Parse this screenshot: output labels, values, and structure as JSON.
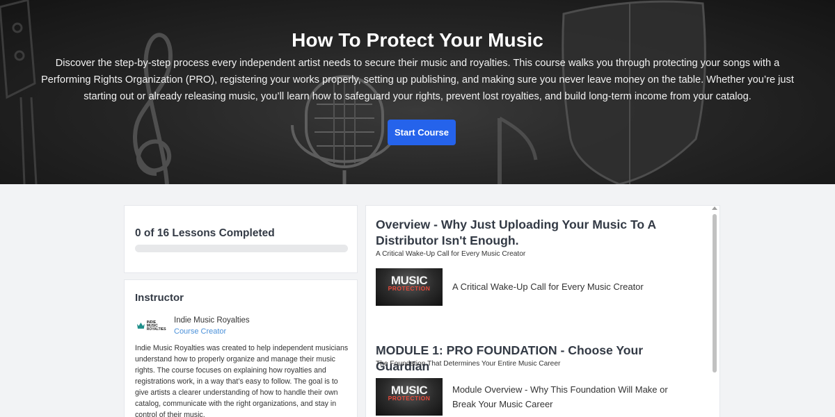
{
  "hero": {
    "title": "How To Protect Your Music",
    "description": "Discover the step-by-step process every independent artist needs to secure their music and royalties. This course walks you through protecting your songs with a Performing Rights Organization (PRO), registering your works properly, setting up publishing, and making sure you never leave money on the table. Whether you’re just starting out or already releasing music, you’ll learn how to safeguard your rights, prevent lost royalties, and build long-term income from your catalog.",
    "start_button": "Start Course"
  },
  "progress": {
    "label": "0 of 16 Lessons Completed",
    "completed": 0,
    "total": 16,
    "fraction": 0
  },
  "instructor": {
    "heading": "Instructor",
    "logo_text_line1": "INDIE MUSIC",
    "logo_text_line2": "ROYALTIES",
    "name": "Indie Music Royalties",
    "role": "Course Creator",
    "bio": "Indie Music Royalties was created to help independent musicians understand how to properly organize and manage their music rights. The course focuses on explaining how royalties and registrations work, in a way that’s easy to follow. The goal is to give artists a clearer understanding of how to handle their own catalog, communicate with the right organizations, and stay in control of their music."
  },
  "modules": [
    {
      "title": "Overview - Why Just Uploading Your Music To A Distributor Isn't Enough.",
      "subtitle": "A Critical Wake-Up Call for Every Music Creator",
      "lessons": [
        {
          "thumb_line1": "MUSIC",
          "thumb_line2": "PROTECTION",
          "title": "A Critical Wake-Up Call for Every Music Creator"
        }
      ]
    },
    {
      "title": "MODULE 1: PRO FOUNDATION - Choose Your Guardian",
      "subtitle": "The Foundation That Determines Your Entire Music Career",
      "lessons": [
        {
          "thumb_line1": "MUSIC",
          "thumb_line2": "PROTECTION",
          "title": "Module Overview - Why This Foundation Will Make or Break Your Music Career"
        }
      ]
    }
  ],
  "colors": {
    "accent": "#2563eb",
    "link": "#4a90d9",
    "heading": "#333a45",
    "page_bg": "#f2f3f5"
  },
  "icons": {
    "logo": "crown-icon",
    "scroll": "chevron-up-icon"
  }
}
